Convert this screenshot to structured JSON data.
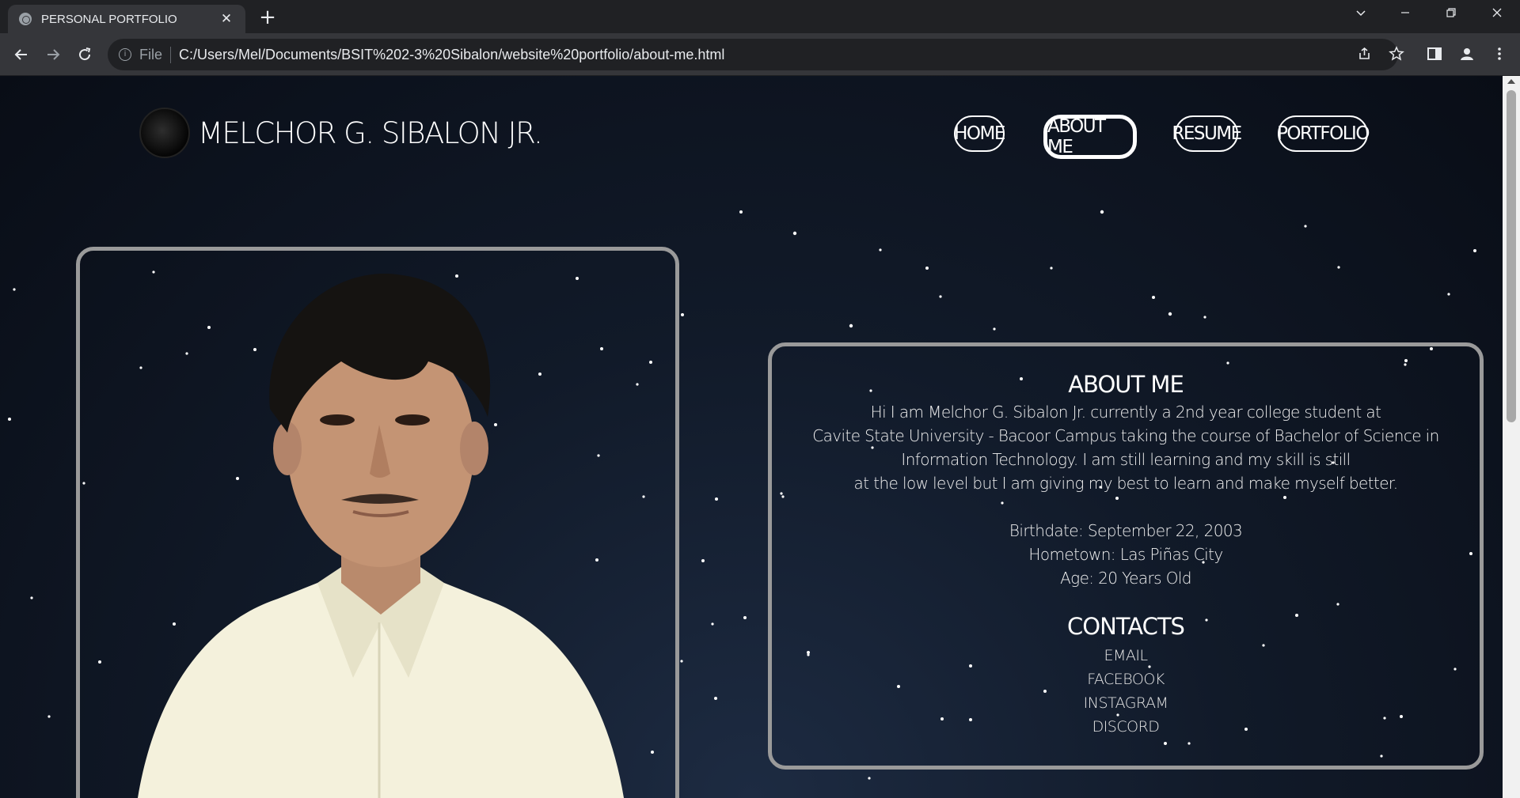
{
  "browser": {
    "tab_title": "PERSONAL PORTFOLIO",
    "tab_close": "✕",
    "new_tab": "+",
    "protocol_label": "File",
    "url": "C:/Users/Mel/Documents/BSIT%202-3%20Sibalon/website%20portfolio/about-me.html",
    "icons": [
      "globe-icon",
      "back-arrow-icon",
      "forward-arrow-icon",
      "reload-icon",
      "info-icon",
      "share-icon",
      "star-icon",
      "sidepanel-icon",
      "profile-icon",
      "menu-icon",
      "minimize-icon",
      "restore-icon",
      "close-icon",
      "tab-search-icon"
    ]
  },
  "site": {
    "brand_name": "MELCHOR G. SIBALON JR.",
    "nav": [
      {
        "label": "HOME",
        "active": false
      },
      {
        "label": "ABOUT ME",
        "active": true
      },
      {
        "label": "RESUME",
        "active": false
      },
      {
        "label": "PORTFOLIO",
        "active": false
      }
    ],
    "photo_alt": "Portrait photo",
    "about": {
      "heading": "ABOUT ME",
      "bio_lines": [
        "Hi I am Melchor G. Sibalon Jr. currently a 2nd year college student at",
        "Cavite State University - Bacoor Campus taking the course of Bachelor of Science in",
        "Information Technology. I am still learning and my skill is still",
        "at the low level but I am giving my best to learn and make myself better."
      ],
      "birthdate": "Birthdate: September 22, 2003",
      "hometown": "Hometown: Las Piñas City",
      "age": "Age: 20 Years Old",
      "contacts_heading": "CONTACTS",
      "contacts": [
        "EMAIL",
        "FACEBOOK",
        "INSTAGRAM",
        "DISCORD"
      ]
    }
  },
  "colors": {
    "chrome_dark": "#202124",
    "chrome_tab": "#35363a",
    "page_bg": "#0d1420",
    "frame_border": "#9a9a9a",
    "text": "#ffffff"
  }
}
